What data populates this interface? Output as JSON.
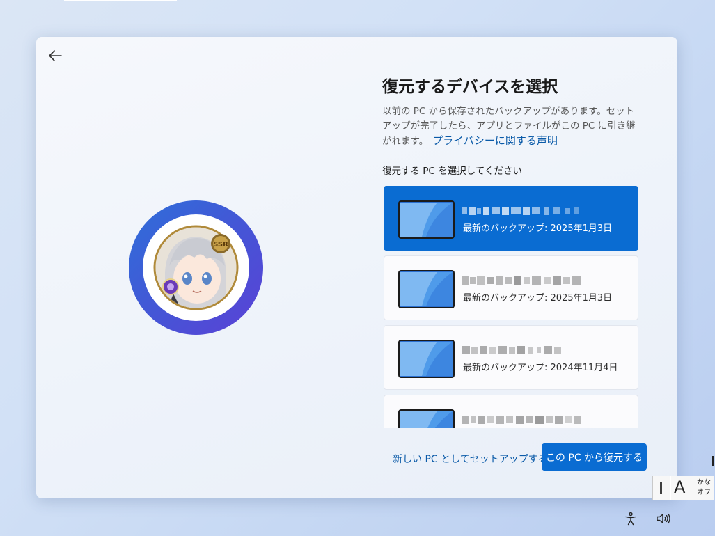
{
  "window": {
    "title": "復元するデバイスを選択",
    "description_lines": [
      "以前の PC から保存されたバックアップがあります。セット",
      "アップが完了したら、アプリとファイルがこの PC に引き継",
      "がれます。"
    ],
    "privacy_link": "プライバシーに関する声明",
    "prompt": "復元する PC を選択してください",
    "devices": [
      {
        "backup": "最新のバックアップ: 2025年1月3日",
        "selected": true
      },
      {
        "backup": "最新のバックアップ: 2025年1月3日",
        "selected": false
      },
      {
        "backup": "最新のバックアップ: 2024年11月4日",
        "selected": false
      },
      {
        "backup": "",
        "selected": false
      }
    ],
    "new_pc_link": "新しい PC としてセットアップする",
    "restore_button": "この PC から復元する"
  },
  "ime": {
    "mode_letter": "A",
    "kana_line1": "かな",
    "kana_line2": "オフ"
  },
  "icons": {
    "back": "back-arrow-icon",
    "accessibility": "accessibility-icon",
    "volume": "volume-icon"
  },
  "colors": {
    "accent": "#0a6cd2",
    "link": "#0a5aa8",
    "avatar_ring": "#4456d6"
  }
}
